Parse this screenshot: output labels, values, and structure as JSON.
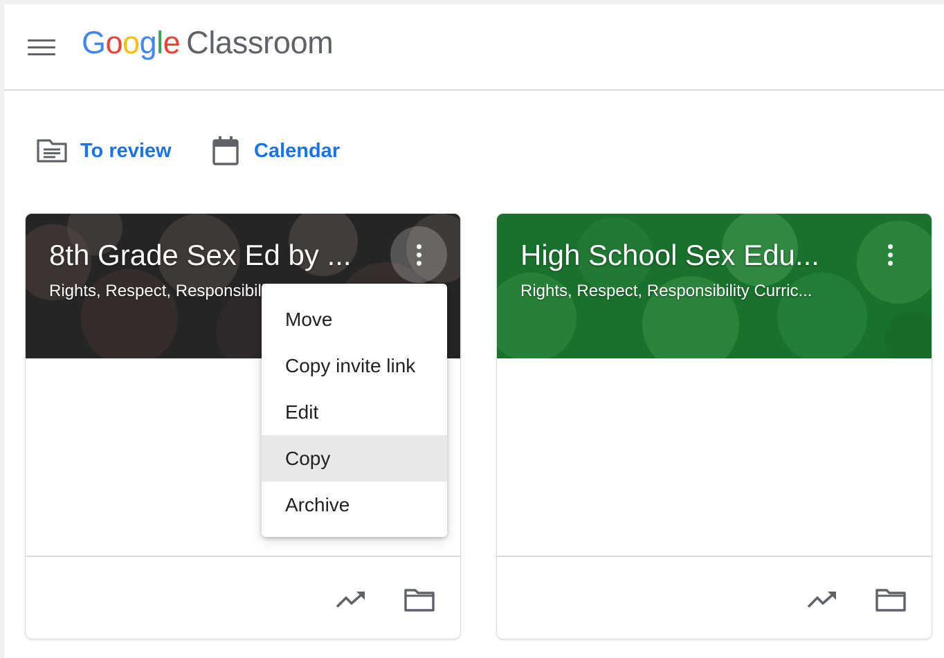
{
  "header": {
    "logo_google_letters": [
      {
        "char": "G",
        "color": "#4285F4"
      },
      {
        "char": "o",
        "color": "#EA4335"
      },
      {
        "char": "o",
        "color": "#FBBC05"
      },
      {
        "char": "g",
        "color": "#4285F4"
      },
      {
        "char": "l",
        "color": "#34A853"
      },
      {
        "char": "e",
        "color": "#EA4335"
      }
    ],
    "logo_product": "Classroom",
    "menu_icon": "hamburger-menu-icon"
  },
  "shortcuts": {
    "to_review": {
      "label": "To review",
      "icon": "assignment-icon"
    },
    "calendar": {
      "label": "Calendar",
      "icon": "calendar-icon"
    }
  },
  "classes": [
    {
      "title": "8th Grade Sex Ed by ...",
      "subtitle": "Rights, Respect, Responsibility Curriculum",
      "banner_tint": "#3a3a3a",
      "icons": [
        "more-vert-icon",
        "trending-up-icon",
        "folder-icon"
      ]
    },
    {
      "title": "High School Sex Edu...",
      "subtitle": "Rights, Respect, Responsibility Curric...",
      "banner_tint": "#1e7a32",
      "icons": [
        "more-vert-icon",
        "trending-up-icon",
        "folder-icon"
      ]
    }
  ],
  "class_menu": {
    "items": [
      "Move",
      "Copy invite link",
      "Edit",
      "Copy",
      "Archive"
    ],
    "highlighted": "Copy"
  },
  "colors": {
    "accent": "#1a73e8",
    "icon_gray": "#5f6368",
    "divider": "#dadce0"
  }
}
